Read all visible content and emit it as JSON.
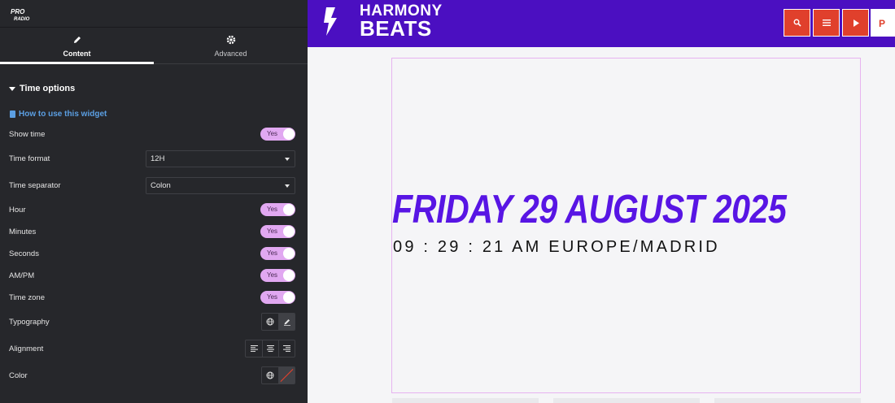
{
  "panel": {
    "logo_text": "PRO RADIO",
    "tabs": [
      {
        "label": "Content",
        "icon": "pencil-icon",
        "active": true
      },
      {
        "label": "Advanced",
        "icon": "gear-icon",
        "active": false
      }
    ],
    "section_title": "Time options",
    "howto_link": "How to use this widget",
    "controls": {
      "show_time": {
        "label": "Show time",
        "value": "Yes"
      },
      "time_format": {
        "label": "Time format",
        "value": "12H"
      },
      "time_separator": {
        "label": "Time separator",
        "value": "Colon"
      },
      "hour": {
        "label": "Hour",
        "value": "Yes"
      },
      "minutes": {
        "label": "Minutes",
        "value": "Yes"
      },
      "seconds": {
        "label": "Seconds",
        "value": "Yes"
      },
      "ampm": {
        "label": "AM/PM",
        "value": "Yes"
      },
      "time_zone": {
        "label": "Time zone",
        "value": "Yes"
      },
      "typography": {
        "label": "Typography"
      },
      "alignment": {
        "label": "Alignment",
        "selected": "right"
      },
      "color": {
        "label": "Color"
      }
    }
  },
  "site": {
    "brand_line1": "HARMONY",
    "brand_line2": "BEATS",
    "brand_circle_text": "HARMONY BEATS",
    "header_color": "#4b0fc1",
    "button_color": "#e0402c",
    "partial_button_label": "P",
    "date_text": "FRIDAY 29  AUGUST  2025",
    "time_text": "09 : 29 : 21 AM EUROPE/MADRID",
    "date_color": "#5815e4"
  }
}
